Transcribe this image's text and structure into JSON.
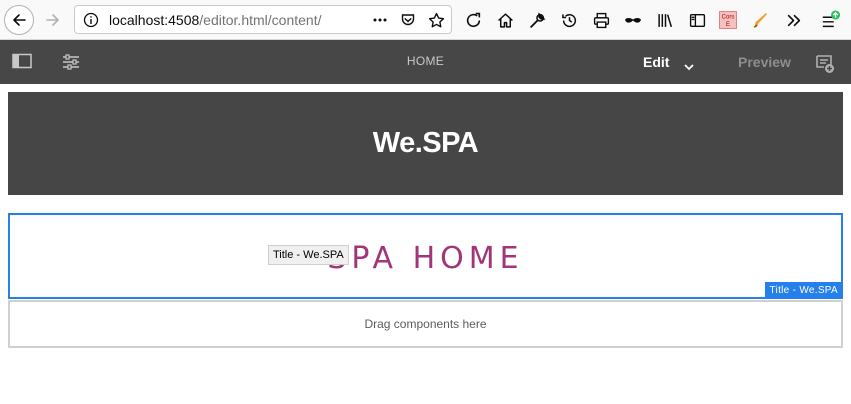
{
  "browser": {
    "url_host": "localhost:4508",
    "url_path": "/editor.html/content/",
    "cors_label_top": "Cors",
    "cors_label_bottom": "E",
    "icons": [
      "back-icon",
      "forward-icon",
      "info-icon",
      "more-icon",
      "pocket-icon",
      "bookmark-star-icon",
      "reload-icon",
      "home-icon",
      "wrench-icon",
      "history-icon",
      "print-icon",
      "mask-icon",
      "library-icon",
      "sidebar-icon",
      "cors-extension-icon",
      "paint-brush-icon",
      "overflow-icon",
      "menu-icon"
    ]
  },
  "editor": {
    "page_name": "HOME",
    "mode_label": "Edit",
    "preview_label": "Preview"
  },
  "page": {
    "site_title": "We.SPA",
    "component_heading": "SPA HOME",
    "tooltip": "Title - We.SPA",
    "component_label": "Title - We.SPA",
    "dropzone_text": "Drag components here"
  },
  "colors": {
    "accent": "#2680eb",
    "heading_color": "#a0357a",
    "header_bg": "#464646",
    "editor_bar_bg": "#474747"
  }
}
